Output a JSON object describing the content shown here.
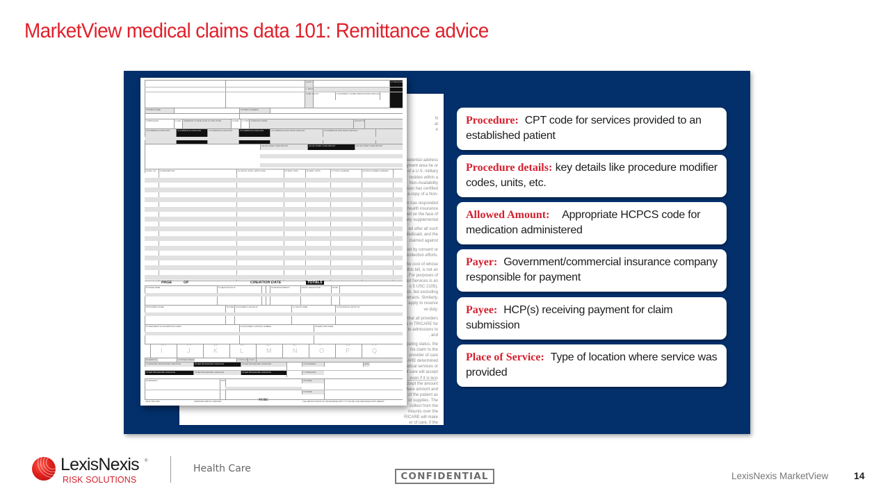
{
  "slide": {
    "title": "MarketView medical claims data 101:  Remittance advice",
    "title_color": "#e0202a",
    "panel_color": "#03306b",
    "accent_term_color": "#d3202e"
  },
  "form_image": {
    "description": "UB-04 claim form sample",
    "labels": {
      "type_of_bill": "4 TYPE OF BILL",
      "pat_cntl": "3a PAT CNTL #",
      "med_rec": "b. MED REC. #",
      "fed_tax": "5 FED. TAX NO.",
      "statement_period": "6 STATEMENT COVERS PERIOD FROM THROUGH",
      "patient_name": "8 PATIENT NAME",
      "patient_address": "9 PATIENT ADDRESS",
      "birthdate": "10 BIRTHDATE",
      "sex": "11 SEX",
      "admission": "ADMISSION 12 DATE 13 HR 14 TYPE 15 SRC",
      "dhr": "16 DHR",
      "stat": "17 STAT",
      "condition_codes": "CONDITION CODES",
      "acdt_state": "29 ACDT STATE",
      "occurrence": "OCCURRENCE CODE DATE",
      "occurrence_span": "OCCURRENCE SPAN FROM THROUGH",
      "value_codes": "VALUE CODES CODE AMOUNT",
      "rev_cd": "42 REV. CD.",
      "description": "43 DESCRIPTION",
      "hcpcs": "44 HCPCS / RATE / HIPPS CODE",
      "serv_date": "45 SERV. DATE",
      "serv_units": "46 SERV. UNITS",
      "total_charges": "47 TOTAL CHARGES",
      "non_covered": "48 NON-COVERED CHARGES",
      "page": "PAGE",
      "of": "OF",
      "creation_date": "CREATION DATE",
      "totals": "TOTALS",
      "payer_name": "50 PAYER NAME",
      "health_plan_id": "51 HEALTH PLAN ID",
      "prior_payments": "54 PRIOR PAYMENTS",
      "est_amount_due": "55 EST. AMOUNT DUE",
      "npi": "56 NPI",
      "other": "OTHER",
      "prv_id": "PRV ID",
      "insured_name": "58 INSURED'S NAME",
      "p_rel": "59 P.REL",
      "insured_id": "60 INSURED'S UNIQUE ID",
      "group_name": "61 GROUP NAME",
      "insurance_group_no": "62 INSURANCE GROUP NO.",
      "treatment_auth": "63 TREATMENT AUTHORIZATION CODES",
      "document_control": "64 DOCUMENT CONTROL NUMBER",
      "employer_name": "65 EMPLOYER NAME",
      "dx_letters": [
        "67",
        "A",
        "B",
        "C",
        "D",
        "E",
        "F",
        "G",
        "H"
      ],
      "dx_letters_2": [
        "I",
        "J",
        "K",
        "L",
        "M",
        "N",
        "O",
        "P",
        "Q"
      ],
      "admit_dx": "69 ADMIT DX",
      "patient_reason_dx": "70 PATIENT REASON DX",
      "pps_code": "71 PPS CODE",
      "eci": "72 ECI",
      "principal_procedure": "74 PRINCIPAL PROCEDURE CODE DATE",
      "other_procedure": "OTHER PROCEDURE CODE DATE",
      "attending": "76 ATTENDING",
      "operating": "77 OPERATING",
      "other_prov": "78 OTHER",
      "other_prov_2": "79 OTHER",
      "last": "LAST",
      "first": "FIRST",
      "qual": "QUAL",
      "remarks": "80 REMARKS",
      "cc": "81CC",
      "form_id": "UB-04 CMS-1450",
      "omb": "APPROVED OMB NO. 0938-0997",
      "nubc": "NUBC",
      "certification": "THE CERTIFICATIONS ON THE REVERSE APPLY TO THIS BILL AND ARE MADE A PART HEREOF."
    },
    "back_text": [
      "N",
      "at",
      "e",
      "esidential address",
      "loyment area he or",
      "of a U.S. military",
      "resides within a",
      "Non-Availability",
      "cian has certified",
      "a copy of a Non-",
      "n has responded",
      "health insurance",
      "ed on the face of",
      "ely supplemental",
      "ed after all such",
      "Medicaid, and the",
      "claimed against",
      "ed by consent or",
      "collection efforts.",
      "he cost of whose",
      "this bill, is not an",
      ". For purposes of",
      "ed Services is an",
      "o 5 USC 2105),",
      "ck, but excluding",
      "ntracts. Similarly,",
      "apply to reserve",
      "ve duty.",
      "that all providers",
      "e in TRICARE for",
      "to admissions to",
      ", and",
      "ipating status, the",
      "his claim to the",
      "provider of care",
      "ARE determined",
      "edical services or",
      "of care will accept",
      "even if it is less",
      "ccept the amount",
      "hare amount and",
      "of the patient as",
      "or supplies. The",
      "collect from the",
      "mounts over the",
      "RICARE will make",
      "er of care, if the"
    ]
  },
  "callouts": [
    {
      "term": "Procedure:",
      "description": "CPT code for services provided to an established patient"
    },
    {
      "term": "Procedure details:",
      "description": "key details like procedure modifier codes, units, etc."
    },
    {
      "term": "Allowed Amount:",
      "description": "Appropriate HCPCS code for medication administered"
    },
    {
      "term": "Payer:",
      "description": "Government/commercial insurance company responsible for payment"
    },
    {
      "term": "Payee:",
      "description": "HCP(s) receiving payment for claim submission"
    },
    {
      "term": "Place of Service:",
      "description": "Type of location where service was provided"
    }
  ],
  "footer": {
    "logo": {
      "icon": "lexisnexis-globe-icon",
      "name": "LexisNexis",
      "registered": "®",
      "tagline": "RISK SOLUTIONS"
    },
    "division": "Health Care",
    "confidential_label": "CONFIDENTIAL",
    "product": "LexisNexis MarketView",
    "page_number": "14"
  }
}
